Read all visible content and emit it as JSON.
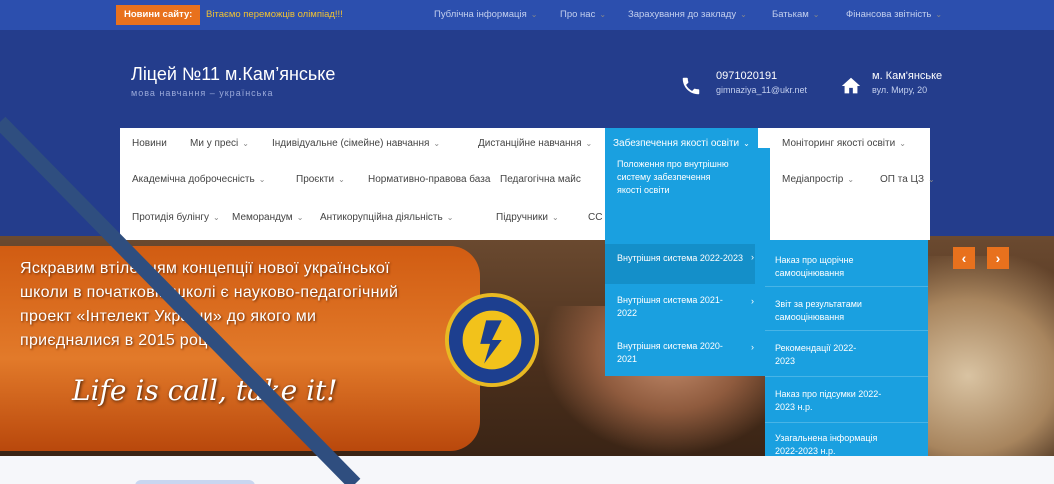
{
  "topbar": {
    "news_label": "Новини сайту:",
    "news_text": "Вітаємо переможців олімпіад!!!",
    "menu": [
      "Публічна інформація",
      "Про нас",
      "Зарахування до закладу",
      "Батькам",
      "Фінансова звітність"
    ]
  },
  "header": {
    "title": "Ліцей №11 м.Кам’янське",
    "subtitle": "мова навчання – українська",
    "phone": "0971020191",
    "email": "gimnaziya_11@ukr.net",
    "city": "м. Кам'янське",
    "street": "вул. Миру, 20"
  },
  "nav": {
    "row1": [
      "Новини",
      "Ми у пресі",
      "Індивідуальне (сімейне) навчання",
      "Дистанційне навчання",
      "Забезпечення якості освіти",
      "Моніторинг якості освіти"
    ],
    "row2": [
      "Академічна доброчесність",
      "Проєкти",
      "Нормативно-правова база",
      "Педагогічна майс",
      "Медіапростір",
      "ОП та ЦЗ"
    ],
    "row3": [
      "Протидія булінгу",
      "Меморандум",
      "Антикорупційна діяльність",
      "Підручники",
      "СС"
    ]
  },
  "dropdown1": [
    "Положення про внутрішню систему забезпечення якості освіти",
    "Внутрішня система 2022-2023",
    "Внутрішня система 2021-2022",
    "Внутрішня система 2020-2021"
  ],
  "dropdown2": [
    "Наказ про щорічне самооцінювання",
    "Звіт за результатами самооцінювання",
    "Рекомендації 2022-2023",
    "Наказ про підсумки 2022-2023 н.р.",
    "Узагальнена інформація 2022-2023 н.р."
  ],
  "hero": {
    "lines": [
      "Яскравим втіленням концепції нової української",
      "школи в початковій школі є науково-педагогічний",
      "проект «Інтелект України» до якого ми",
      "приєдналися в 2015 році"
    ],
    "slogan": "Life is call, take it!",
    "prev": "‹",
    "next": "›"
  },
  "colors": {
    "topbar": "#2c4fae",
    "header": "#243d8c",
    "accent": "#1aa0e0",
    "orange": "#e8711d"
  }
}
